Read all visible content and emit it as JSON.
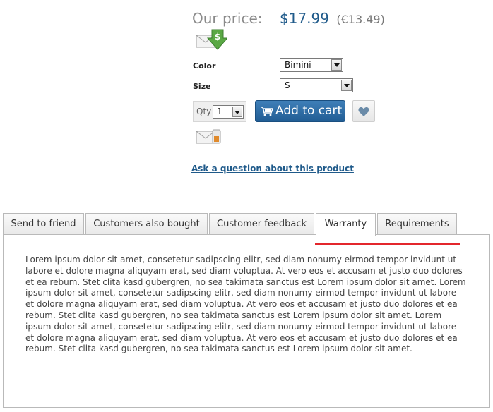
{
  "price": {
    "label": "Our price:",
    "value": "$17.99",
    "alt_value": "(€13.49)"
  },
  "options": {
    "color": {
      "label": "Color",
      "selected": "Bimini"
    },
    "size": {
      "label": "Size",
      "selected": "S"
    }
  },
  "purchase": {
    "qty_label": "Qty",
    "qty_value": "1",
    "add_to_cart_label": "Add to cart"
  },
  "ask_question_link": "Ask a question about this product",
  "tabs": [
    {
      "label": "Send to friend"
    },
    {
      "label": "Customers also bought"
    },
    {
      "label": "Customer feedback"
    },
    {
      "label": "Warranty"
    },
    {
      "label": "Requirements"
    }
  ],
  "active_tab": "Warranty",
  "panel": {
    "text": "Lorem ipsum dolor sit amet, consetetur sadipscing elitr, sed diam nonumy eirmod tempor invidunt ut labore et dolore magna aliquyam erat, sed diam voluptua. At vero eos et accusam et justo duo dolores et ea rebum. Stet clita kasd gubergren, no sea takimata sanctus est Lorem ipsum dolor sit amet. Lorem ipsum dolor sit amet, consetetur sadipscing elitr, sed diam nonumy eirmod tempor invidunt ut labore et dolore magna aliquyam erat, sed diam voluptua. At vero eos et accusam et justo duo dolores et ea rebum. Stet clita kasd gubergren, no sea takimata sanctus est Lorem ipsum dolor sit amet. Lorem ipsum dolor sit amet, consetetur sadipscing elitr, sed diam nonumy eirmod tempor invidunt ut labore et dolore magna aliquyam erat, sed diam voluptua. At vero eos et accusam et justo duo dolores et ea rebum. Stet clita kasd gubergren, no sea takimata sanctus est Lorem ipsum dolor sit amet."
  },
  "icons": {
    "price_notify": "envelope-dollar-icon",
    "stock_notify": "envelope-bottle-icon",
    "cart": "cart-icon",
    "wishlist": "heart-icon"
  },
  "colors": {
    "price": "#1f5a8a",
    "button": "#215d94",
    "active_tab_underline": "#e3262c"
  }
}
